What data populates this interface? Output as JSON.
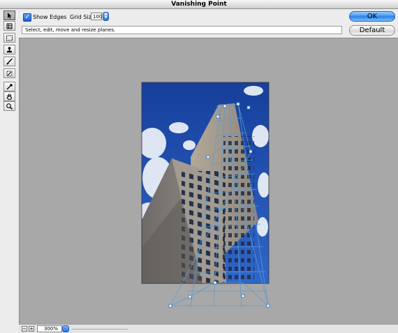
{
  "window": {
    "title": "Vanishing Point"
  },
  "options": {
    "show_edges_label": "Show Edges",
    "show_edges_checked": true,
    "grid_size_label": "Grid Size:",
    "grid_size_value": "100"
  },
  "status_text": "Select, edit, move and resize planes.",
  "buttons": {
    "ok": "OK",
    "default": "Default"
  },
  "tools": [
    {
      "name": "edit-plane-tool",
      "icon": "arrow-icon",
      "active": true
    },
    {
      "name": "create-plane-tool",
      "icon": "create-plane-icon"
    },
    {
      "name": "marquee-tool",
      "icon": "marquee-icon"
    },
    {
      "name": "stamp-tool",
      "icon": "stamp-icon"
    },
    {
      "name": "brush-tool",
      "icon": "brush-icon"
    },
    {
      "name": "transform-tool",
      "icon": "transform-icon"
    },
    {
      "name": "eyedropper-tool",
      "icon": "eyedropper-icon"
    },
    {
      "name": "hand-tool",
      "icon": "hand-icon"
    },
    {
      "name": "zoom-tool",
      "icon": "magnifier-icon"
    }
  ],
  "zoom": {
    "value": "300%",
    "minus": "−",
    "plus": "+"
  },
  "colors": {
    "grid_line": "#5b9bd5",
    "sky": "#1f4fae",
    "ok_button": "#3a8ef0",
    "canvas_bg": "#a8a8a8"
  }
}
